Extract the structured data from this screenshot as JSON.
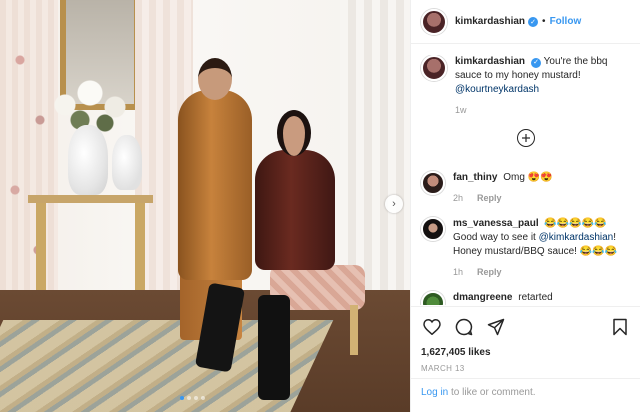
{
  "post": {
    "username": "kimkardashian",
    "verified_mark": "✓",
    "separator": "•",
    "follow_label": "Follow",
    "caption": "You're the bbq sauce to my honey mustard!",
    "caption_mention": "@kourtneykardash",
    "caption_time": "1w",
    "likes": "1,627,405 likes",
    "date": "MARCH 13"
  },
  "load_more_icon": "plus-circle-icon",
  "comments": [
    {
      "username": "fan_thiny",
      "text": "Omg 😍😍",
      "time": "2h",
      "reply_label": "Reply"
    },
    {
      "username": "ms_vanessa_paul",
      "text": "😂😂😂😂😂Good way to see it ",
      "mention": "@kimkardashian",
      "text_after": "! Honey mustard/BBQ sauce! 😂😂😂",
      "time": "1h",
      "reply_label": "Reply"
    },
    {
      "username": "dmangreene",
      "text": "retarted"
    }
  ],
  "actions": {
    "like_icon": "heart-icon",
    "comment_icon": "comment-icon",
    "share_icon": "share-icon",
    "save_icon": "bookmark-icon"
  },
  "login": {
    "link_text": "Log in",
    "rest_text": " to like or comment."
  },
  "carousel": {
    "next_glyph": "›",
    "slide_count": 4,
    "active_index": 0
  },
  "colors": {
    "accent": "#3897f0",
    "muted": "#999999",
    "border": "#efefef"
  }
}
